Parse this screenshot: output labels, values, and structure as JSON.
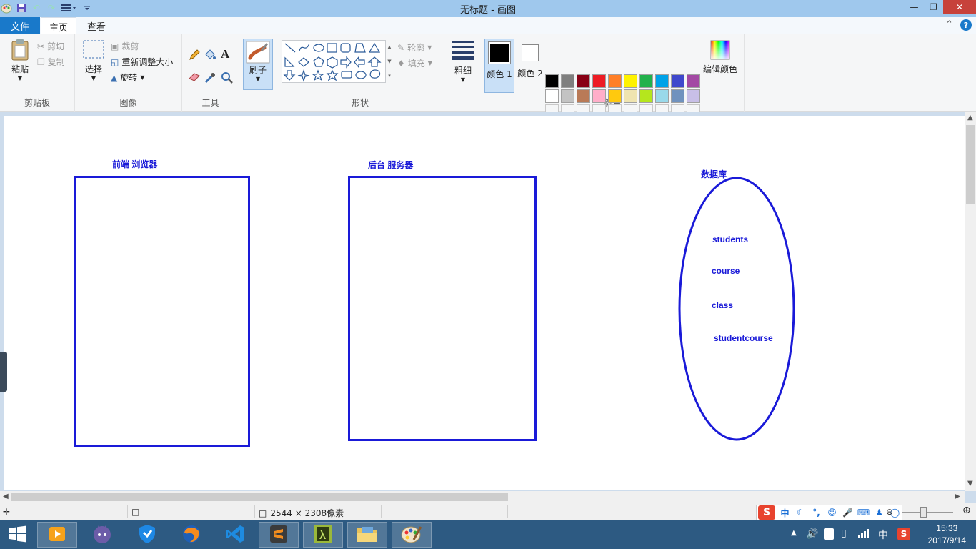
{
  "window": {
    "title": "无标题 - 画图"
  },
  "tabs": {
    "file": "文件",
    "home": "主页",
    "view": "查看"
  },
  "ribbon": {
    "clipboard": {
      "paste": "粘贴",
      "cut": "剪切",
      "copy": "复制",
      "label": "剪贴板"
    },
    "image": {
      "select": "选择",
      "crop": "裁剪",
      "resize": "重新调整大小",
      "rotate": "旋转",
      "label": "图像"
    },
    "tools": {
      "label": "工具"
    },
    "brushes": {
      "label": "刷子"
    },
    "shapes": {
      "outline": "轮廓",
      "fill": "填充",
      "label": "形状"
    },
    "size": {
      "label": "粗细"
    },
    "colors": {
      "color1": "颜色 1",
      "color2": "颜色 2",
      "edit": "编辑颜色",
      "label": "颜色",
      "row1": [
        "#000000",
        "#7f7f7f",
        "#880015",
        "#ed1c24",
        "#ff7f27",
        "#fff200",
        "#22b14c",
        "#00a2e8",
        "#3f48cc",
        "#a349a4"
      ],
      "row2": [
        "#ffffff",
        "#c3c3c3",
        "#b97a57",
        "#ffaec9",
        "#ffc90e",
        "#efe4b0",
        "#b5e61d",
        "#99d9ea",
        "#7092be",
        "#c8bfe7"
      ]
    }
  },
  "canvas": {
    "frontend_label": "前端  浏览器",
    "backend_label": "后台  服务器",
    "database_label": "数据库",
    "tables": [
      "students",
      "course",
      "class",
      "studentcourse"
    ],
    "stroke_color": "#1a1ad8"
  },
  "statusbar": {
    "image_size": "2544 × 2308像素"
  },
  "ime": {
    "mode": "中"
  },
  "taskbar": {
    "tray_lang": "中",
    "time": "15:33",
    "date": "2017/9/14"
  }
}
